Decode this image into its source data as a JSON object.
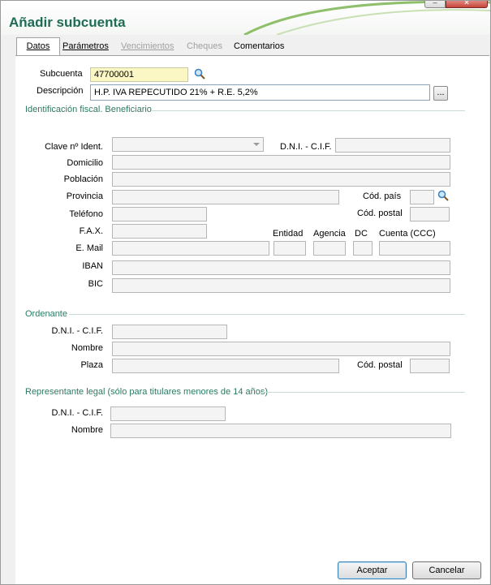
{
  "window": {
    "title": "Añadir subcuenta",
    "minimize_label": "–",
    "close_label": "✕"
  },
  "tabs": [
    {
      "label": "Datos",
      "state": "active"
    },
    {
      "label": "Parámetros",
      "state": "normal"
    },
    {
      "label": "Vencimientos",
      "state": "disabled"
    },
    {
      "label": "Cheques",
      "state": "disabled"
    },
    {
      "label": "Comentarios",
      "state": "normal"
    }
  ],
  "form": {
    "subcuenta_label": "Subcuenta",
    "subcuenta_value": "47700001",
    "descripcion_label": "Descripción",
    "descripcion_value": "H.P. IVA REPECUTIDO 21% + R.E. 5,2%",
    "more_button": "..."
  },
  "beneficiario": {
    "section_title": "Identificación fiscal. Beneficiario",
    "clave_label": "Clave nº Ident.",
    "dni_label": "D.N.I. - C.I.F.",
    "domicilio_label": "Domicilio",
    "poblacion_label": "Población",
    "provincia_label": "Provincia",
    "cod_pais_label": "Cód. país",
    "telefono_label": "Teléfono",
    "cod_postal_label": "Cód. postal",
    "fax_label": "F.A.X.",
    "entidad_label": "Entidad",
    "agencia_label": "Agencia",
    "dc_label": "DC",
    "cuenta_label": "Cuenta (CCC)",
    "email_label": "E. Mail",
    "iban_label": "IBAN",
    "bic_label": "BIC"
  },
  "ordenante": {
    "section_title": "Ordenante",
    "dni_label": "D.N.I. - C.I.F.",
    "nombre_label": "Nombre",
    "plaza_label": "Plaza",
    "cod_postal_label": "Cód. postal"
  },
  "representante": {
    "section_title": "Representante legal (sólo para titulares menores de 14 años)",
    "dni_label": "D.N.I. - C.I.F.",
    "nombre_label": "Nombre"
  },
  "buttons": {
    "accept": "Aceptar",
    "cancel": "Cancelar"
  },
  "colors": {
    "title": "#1f6b54",
    "section": "#2d7a63",
    "highlight_field": "#fbf7c4"
  }
}
